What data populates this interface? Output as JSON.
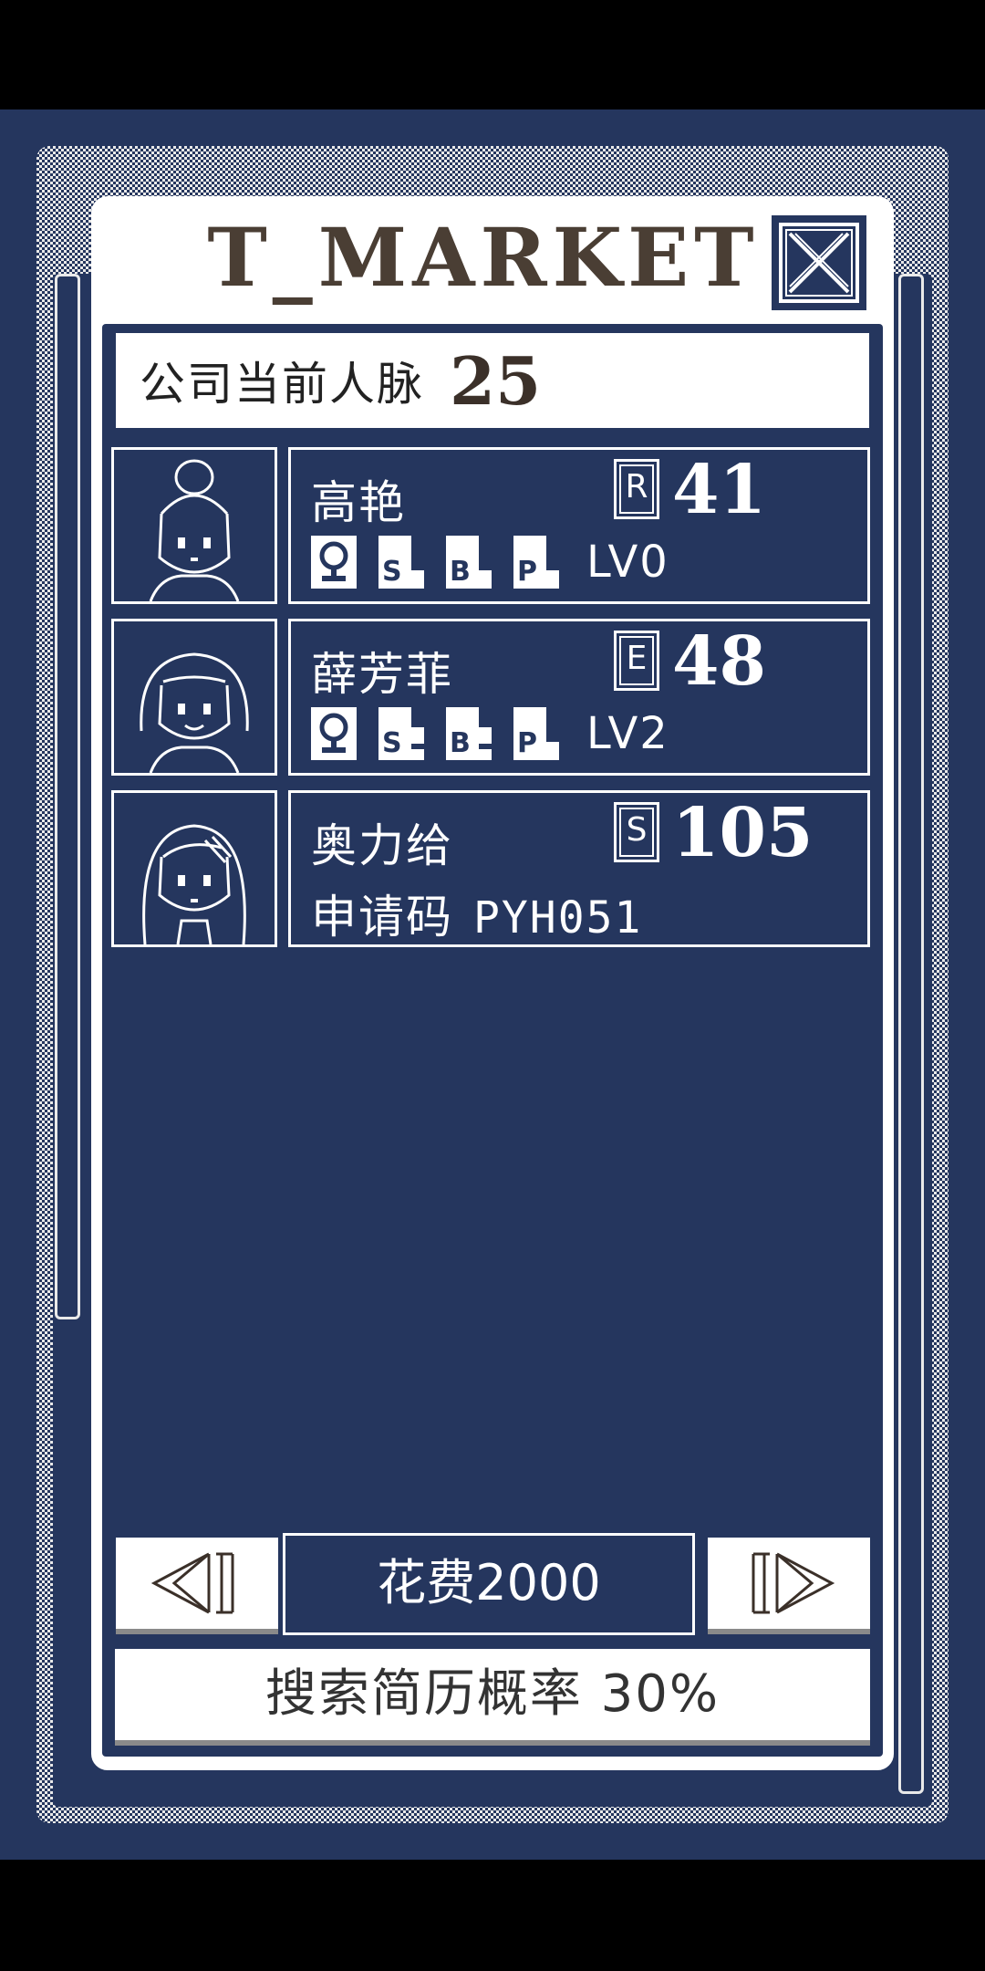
{
  "modal": {
    "title": "T_MARKET",
    "close_icon": "close-x-icon"
  },
  "network": {
    "label": "公司当前人脉",
    "value": "25"
  },
  "candidates": [
    {
      "name": "高艳",
      "rank": "R",
      "score": "41",
      "tags": [
        "female-icon",
        "S",
        "B",
        "P"
      ],
      "level": "LV0",
      "avatar": "bun-hair-avatar"
    },
    {
      "name": "薛芳菲",
      "rank": "E",
      "score": "48",
      "tags": [
        "female-icon",
        "S",
        "B",
        "P"
      ],
      "level": "LV2",
      "avatar": "bob-hair-avatar"
    },
    {
      "name": "奥力给",
      "rank": "S",
      "score": "105",
      "code_label": "申请码",
      "code": "PYH051",
      "avatar": "long-hair-avatar"
    }
  ],
  "controls": {
    "prev_icon": "prev-arrow-icon",
    "next_icon": "next-arrow-icon",
    "cost_label": "花费2000",
    "search_label": "搜索简历概率 30%"
  },
  "colors": {
    "navy": "#25365e",
    "white": "#ffffff",
    "title_brown": "#4a3e34",
    "checker_light": "#e9e9e9"
  }
}
